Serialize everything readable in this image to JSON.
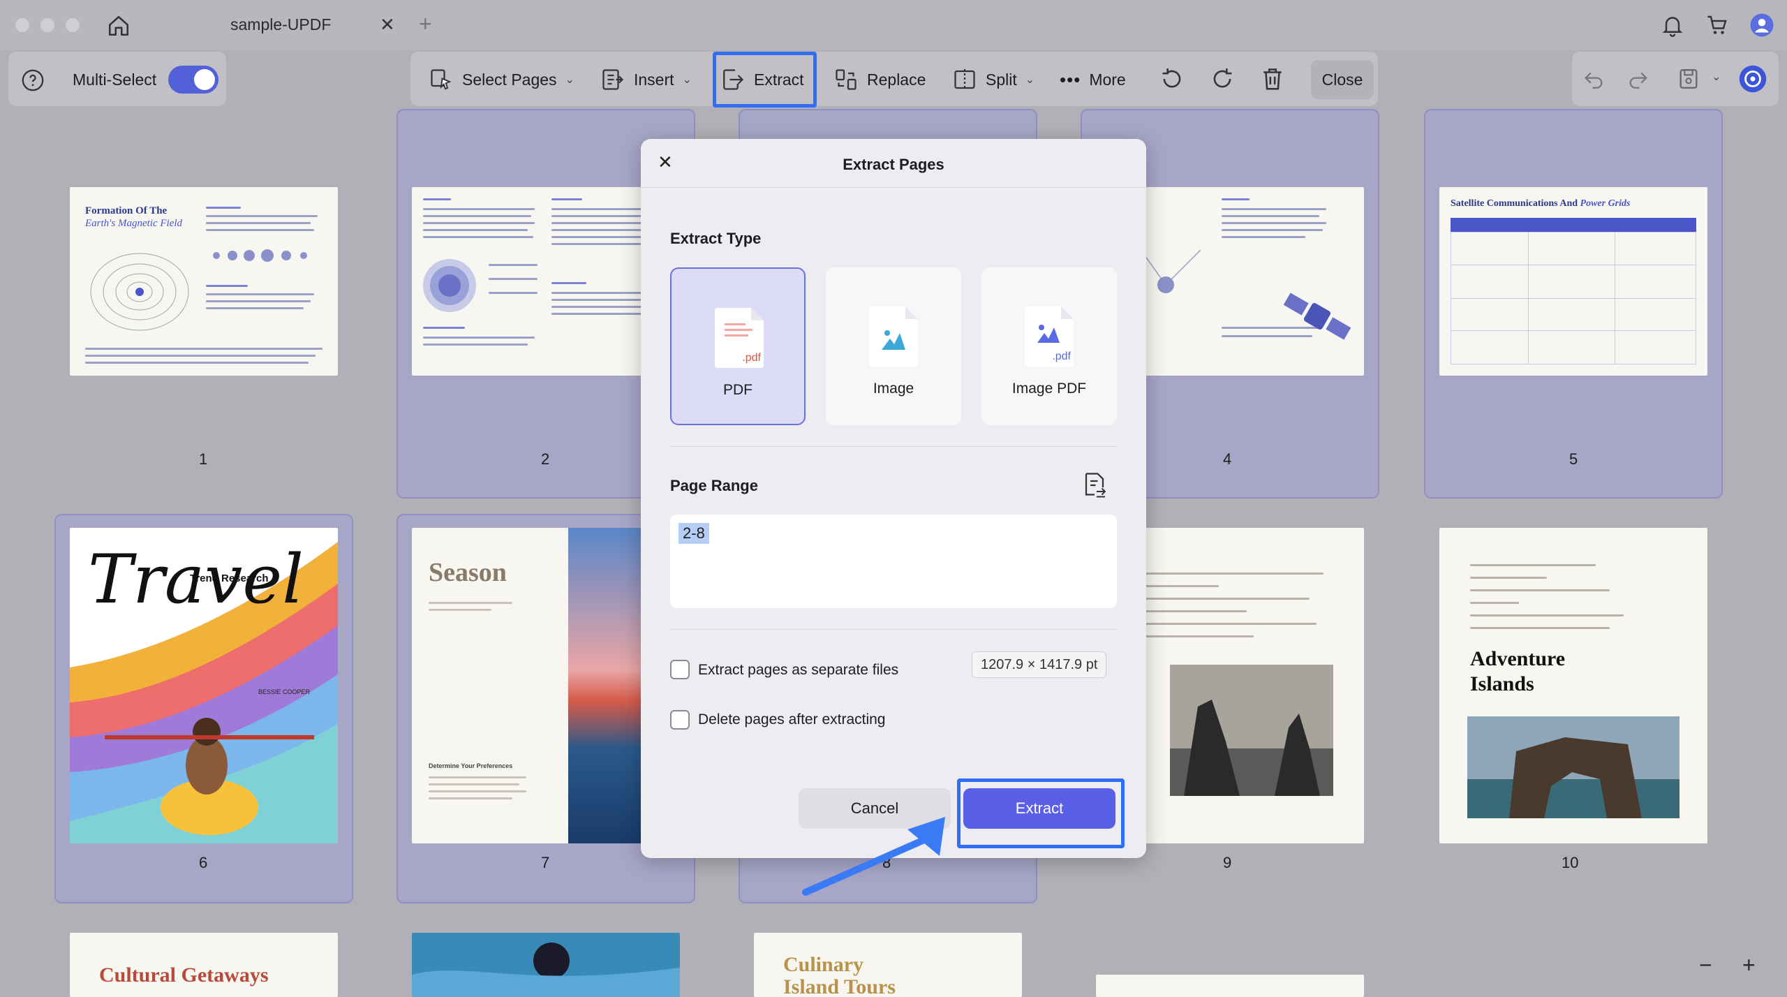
{
  "window": {
    "tab_title": "sample-UPDF"
  },
  "toolbar": {
    "multi_select_label": "Multi-Select",
    "select_pages": "Select Pages",
    "insert": "Insert",
    "extract": "Extract",
    "replace": "Replace",
    "split": "Split",
    "more": "More",
    "close": "Close"
  },
  "pages": {
    "p1_title": "Formation Of The",
    "p1_subtitle": "Earth's Magnetic Field",
    "p5_title": "Satellite Communications And",
    "p5_title_em": "Power Grids",
    "p6_title": "Travel",
    "p6_sub": "Trend Research",
    "p6_author": "BESSIE COOPER",
    "p7_title": "Season",
    "p7_sub": "Determine Your Preferences",
    "p10_title1": "Adventure",
    "p10_title2": "Islands",
    "p11_title": "Cultural Getaways",
    "p13_title1": "Culinary",
    "p13_title2": "Island Tours",
    "numbers": [
      "1",
      "2",
      "4",
      "5",
      "6",
      "7",
      "8",
      "9",
      "10"
    ]
  },
  "dialog": {
    "title": "Extract Pages",
    "extract_type_label": "Extract Type",
    "types": [
      {
        "label": "PDF",
        "icon": "pdf-file-icon",
        "selected": true
      },
      {
        "label": "Image",
        "icon": "image-file-icon",
        "selected": false
      },
      {
        "label": "Image PDF",
        "icon": "image-pdf-file-icon",
        "selected": false
      }
    ],
    "page_range_label": "Page Range",
    "page_range_value": "2-8",
    "separate_files_label": "Extract pages as separate files",
    "separate_files_checked": false,
    "delete_pages_label": "Delete pages after extracting",
    "delete_pages_checked": false,
    "page_dimensions": "1207.9 × 1417.9 pt",
    "cancel": "Cancel",
    "extract": "Extract"
  },
  "colors": {
    "accent": "#5a5fe8",
    "highlight_border": "#2f6ff5",
    "selected_cell": "#a7a6c7"
  }
}
